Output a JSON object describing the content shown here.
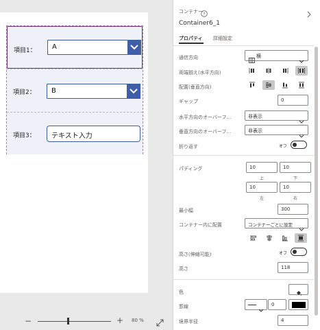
{
  "canvas": {
    "rows": [
      {
        "label": "項目1：",
        "type": "dropdown",
        "value": "A"
      },
      {
        "label": "項目2：",
        "type": "dropdown",
        "value": "B"
      },
      {
        "label": "項目3：",
        "type": "textinput",
        "value": "テキスト入力"
      }
    ],
    "zoom": {
      "minus": "−",
      "plus": "+",
      "level": "80 %"
    }
  },
  "panel": {
    "type_label": "コンテナー",
    "name": "Container6_1",
    "tabs": [
      "プロパティ",
      "詳細設定"
    ],
    "direction": {
      "label": "通信方向",
      "value": "横"
    },
    "justify": {
      "label": "両端揃え(水平方向)"
    },
    "align": {
      "label": "配置(垂直方向)"
    },
    "gap": {
      "label": "ギャップ",
      "value": "0"
    },
    "overflow_h": {
      "label": "水平方向のオーバーフ...",
      "value": "非表示"
    },
    "overflow_v": {
      "label": "垂直方向のオーバーフ...",
      "value": "非表示"
    },
    "wrap": {
      "label": "折り返す",
      "state": "オフ"
    },
    "padding": {
      "label": "パディング",
      "top": "10",
      "bottom": "10",
      "left": "10",
      "right": "10",
      "top_label": "上",
      "bottom_label": "下",
      "left_label": "左",
      "right_label": "右"
    },
    "min_width": {
      "label": "最小幅",
      "value": "300"
    },
    "align_in_container": {
      "label": "コンテナー内に配置",
      "value": "コンテナーごとに設定"
    },
    "flexible_height": {
      "label": "高さ(伸縮可能)",
      "state": "オフ"
    },
    "height": {
      "label": "高さ",
      "value": "118"
    },
    "color": {
      "label": "色"
    },
    "border": {
      "label": "罫線",
      "value": "0",
      "color": "#000000"
    },
    "radius": {
      "label": "境界半径",
      "value": "4"
    }
  },
  "colors": {
    "accent": "#3f5ea8",
    "selection": "#7a2e8c"
  }
}
